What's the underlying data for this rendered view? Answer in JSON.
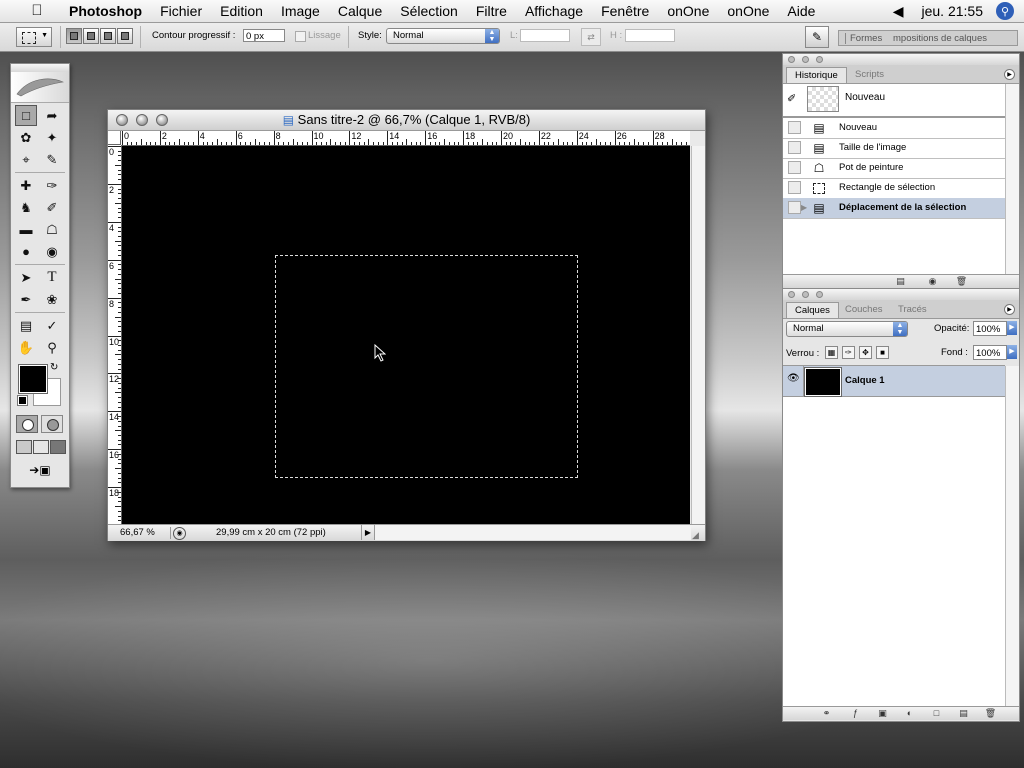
{
  "menubar": {
    "app": "Photoshop",
    "items": [
      "Fichier",
      "Edition",
      "Image",
      "Calque",
      "Sélection",
      "Filtre",
      "Affichage",
      "Fenêtre",
      "onOne",
      "onOne",
      "Aide"
    ],
    "clock": "jeu. 21:55"
  },
  "options": {
    "feather_label": "Contour progressif :",
    "feather_value": "0 px",
    "antialias_label": "Lissage",
    "style_label": "Style:",
    "style_value": "Normal",
    "width_label": "L:",
    "height_label": "H :",
    "well_tabs": [
      "Formes",
      "mpositions de calques"
    ]
  },
  "document": {
    "title": "Sans titre-2 @ 66,7% (Calque 1, RVB/8)",
    "zoom": "66,67 %",
    "doc_info": "29,99 cm x 20 cm (72 ppi)",
    "ruler_h": [
      "0",
      "2",
      "4",
      "6",
      "8",
      "10",
      "12",
      "14",
      "16",
      "18",
      "20",
      "22",
      "24",
      "26",
      "28"
    ],
    "ruler_v": [
      "0",
      "2",
      "4",
      "6",
      "8",
      "10",
      "12",
      "14",
      "16",
      "18"
    ]
  },
  "history": {
    "tabs": [
      "Historique",
      "Scripts"
    ],
    "snapshot_label": "Nouveau",
    "items": [
      {
        "label": "Nouveau",
        "icon": "new-document-icon"
      },
      {
        "label": "Taille de l'image",
        "icon": "image-size-icon"
      },
      {
        "label": "Pot de peinture",
        "icon": "paint-bucket-icon"
      },
      {
        "label": "Rectangle de sélection",
        "icon": "marquee-icon"
      },
      {
        "label": "Déplacement de la sélection",
        "icon": "move-selection-icon"
      }
    ]
  },
  "layers": {
    "tabs": [
      "Calques",
      "Couches",
      "Tracés"
    ],
    "blend_mode": "Normal",
    "opacity_label": "Opacité:",
    "opacity_value": "100%",
    "lock_label": "Verrou :",
    "fill_label": "Fond :",
    "fill_value": "100%",
    "layer_name": "Calque 1"
  },
  "colors": {
    "foreground": "#000000",
    "background": "#ffffff",
    "selection_highlight": "#c4cfe0",
    "spotlight": "#2e5fb8"
  }
}
